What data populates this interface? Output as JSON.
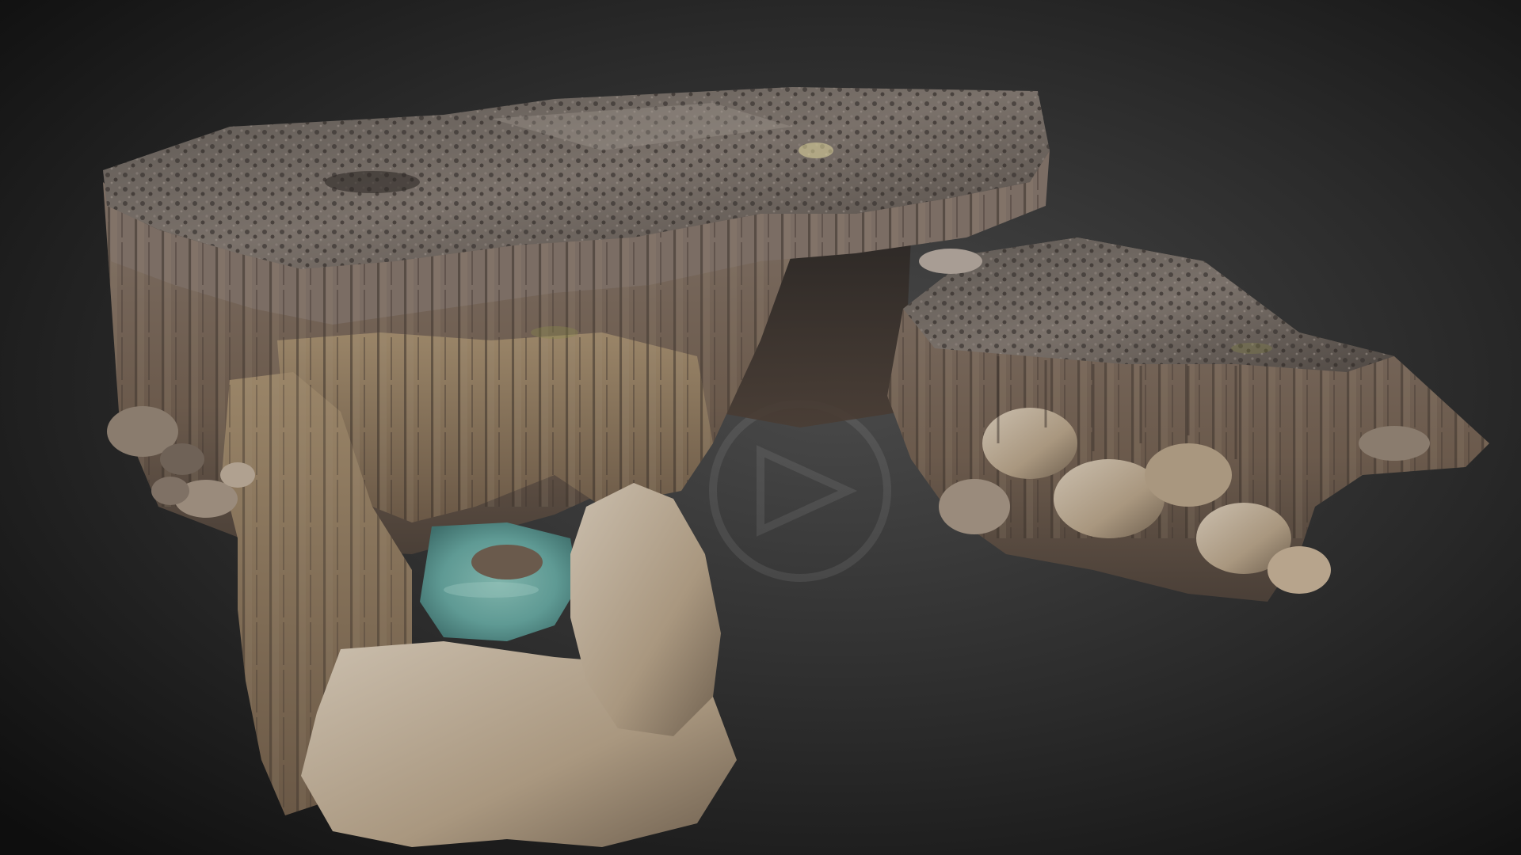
{
  "viewer": {
    "background_colors": {
      "center": "#4a4a4a",
      "mid": "#2a2a2a",
      "edge": "#0e0e0e"
    },
    "watermark_icon": "3d-viewer-logo-icon"
  },
  "scene": {
    "subject": "rock-formation-3d-model",
    "palette": {
      "top_surface": "#6f6660",
      "top_highlight": "#9a918a",
      "dark_rubble": "#3b3532",
      "column_rock": "#8a7766",
      "column_shadow": "#4a3f37",
      "warm_rock": "#a58a6a",
      "tan_boulder": "#b7a48c",
      "light_boulder": "#c9bba8",
      "pool_water": "#5f9a94",
      "pool_deep": "#3f6f6c",
      "moss": "#8a8a4a"
    }
  }
}
